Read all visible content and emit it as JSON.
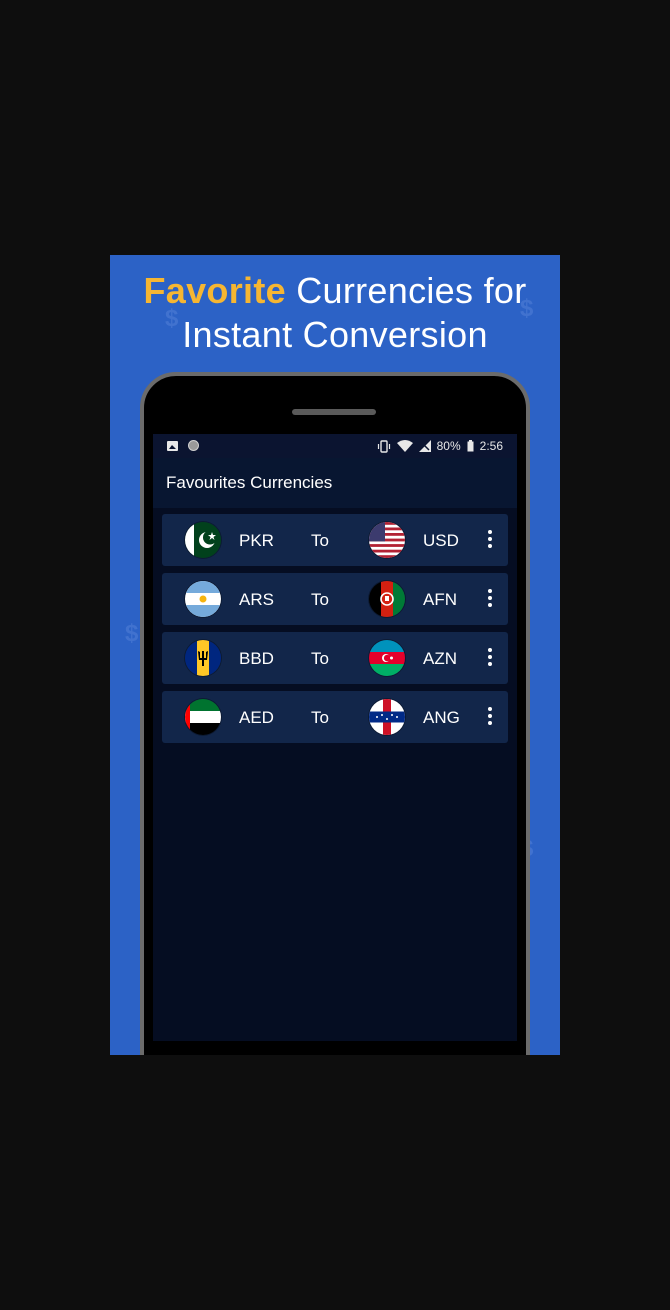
{
  "promo": {
    "headline_highlight": "Favorite",
    "headline_rest_line1": " Currencies for",
    "headline_line2": "Instant Conversion",
    "highlight_color": "#f6b632",
    "background_color": "#2c62c6"
  },
  "status_bar": {
    "battery": "80%",
    "time": "2:56",
    "icons": [
      "image-icon",
      "circle-icon",
      "vibrate-icon",
      "wifi-icon",
      "no-signal-icon",
      "battery-icon"
    ]
  },
  "app_bar": {
    "title": "Favourites Currencies"
  },
  "favourites": [
    {
      "from": "PKR",
      "to_label": "To",
      "to": "USD",
      "from_flag": "pakistan-flag-icon",
      "to_flag": "usa-flag-icon"
    },
    {
      "from": "ARS",
      "to_label": "To",
      "to": "AFN",
      "from_flag": "argentina-flag-icon",
      "to_flag": "afghanistan-flag-icon"
    },
    {
      "from": "BBD",
      "to_label": "To",
      "to": "AZN",
      "from_flag": "barbados-flag-icon",
      "to_flag": "azerbaijan-flag-icon"
    },
    {
      "from": "AED",
      "to_label": "To",
      "to": "ANG",
      "from_flag": "uae-flag-icon",
      "to_flag": "netherlands-antilles-flag-icon"
    }
  ]
}
